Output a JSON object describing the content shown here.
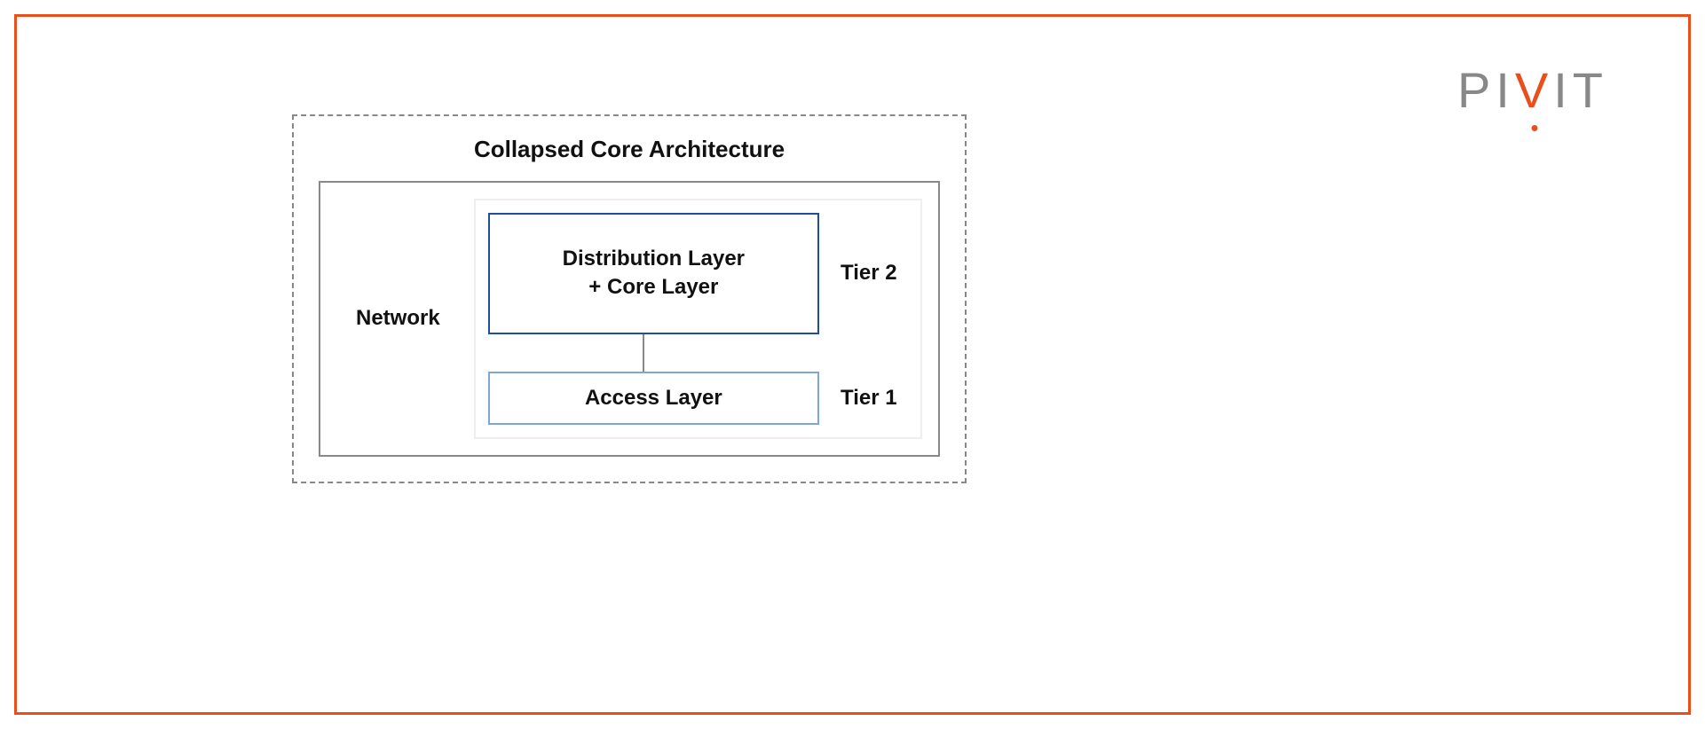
{
  "logo": {
    "part1": "PI",
    "part2": "V",
    "part3": "IT"
  },
  "diagram": {
    "title": "Collapsed Core Architecture",
    "leftLabel": "Network",
    "upperBox": {
      "line1": "Distribution Layer",
      "line2": "+ Core Layer"
    },
    "upperTier": "Tier 2",
    "lowerBox": "Access Layer",
    "lowerTier": "Tier 1"
  }
}
